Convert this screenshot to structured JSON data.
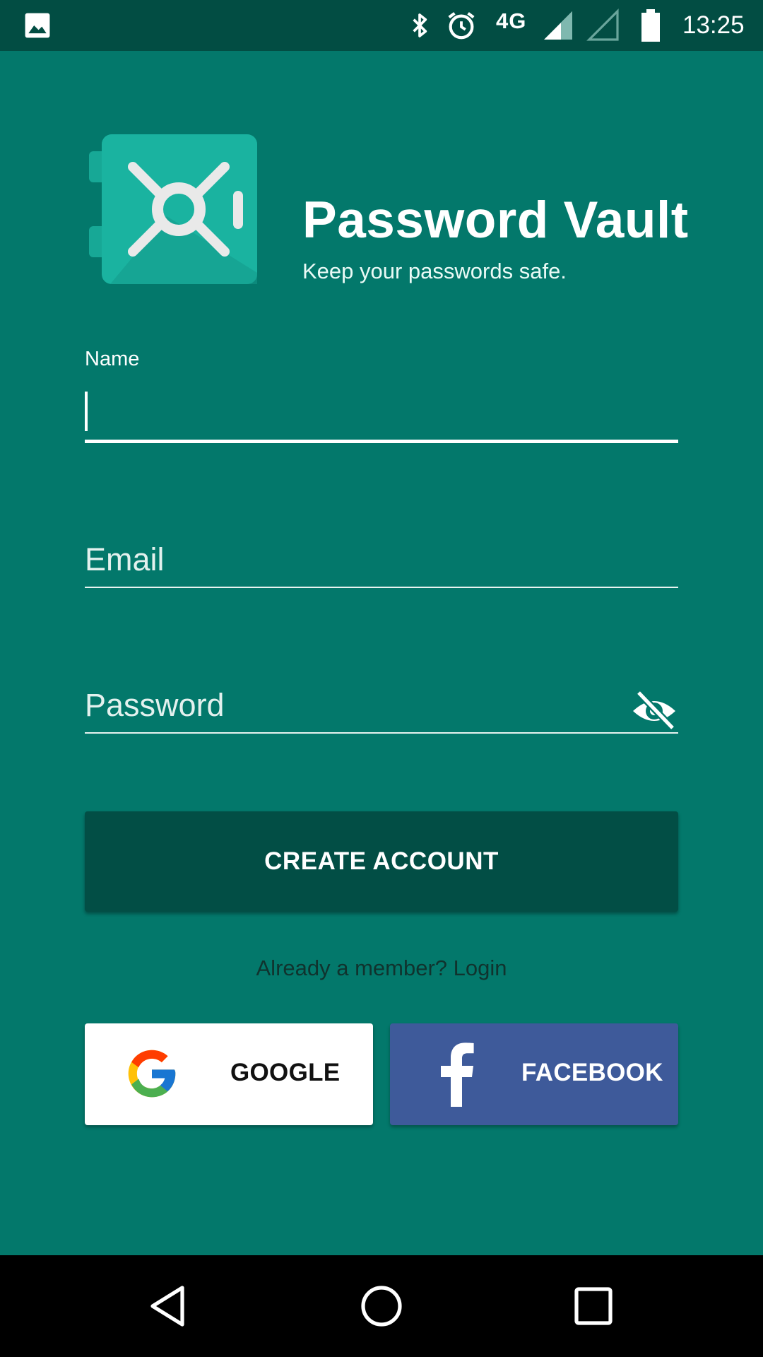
{
  "status_bar": {
    "network": "4G",
    "time": "13:25",
    "icons": [
      "gallery-icon",
      "bluetooth-icon",
      "alarm-icon",
      "signal-icon",
      "signal-empty-icon",
      "battery-icon"
    ]
  },
  "header": {
    "title": "Password Vault",
    "subtitle": "Keep your passwords safe.",
    "logo_icon": "vault-safe-icon"
  },
  "form": {
    "name_label": "Name",
    "name_value": "",
    "email_placeholder": "Email",
    "password_placeholder": "Password",
    "password_toggle_icon": "visibility-off-icon"
  },
  "actions": {
    "create_account_label": "CREATE ACCOUNT",
    "login_prompt": "Already a member? Login",
    "google_label": "GOOGLE",
    "facebook_label": "FACEBOOK"
  },
  "colors": {
    "background": "#03786b",
    "status_bar": "#024d43",
    "primary_button": "#024e45",
    "facebook": "#3e5a9a",
    "logo": "#1ab3a0"
  },
  "nav_bar": {
    "icons": [
      "back-icon",
      "home-icon",
      "recents-icon"
    ]
  }
}
